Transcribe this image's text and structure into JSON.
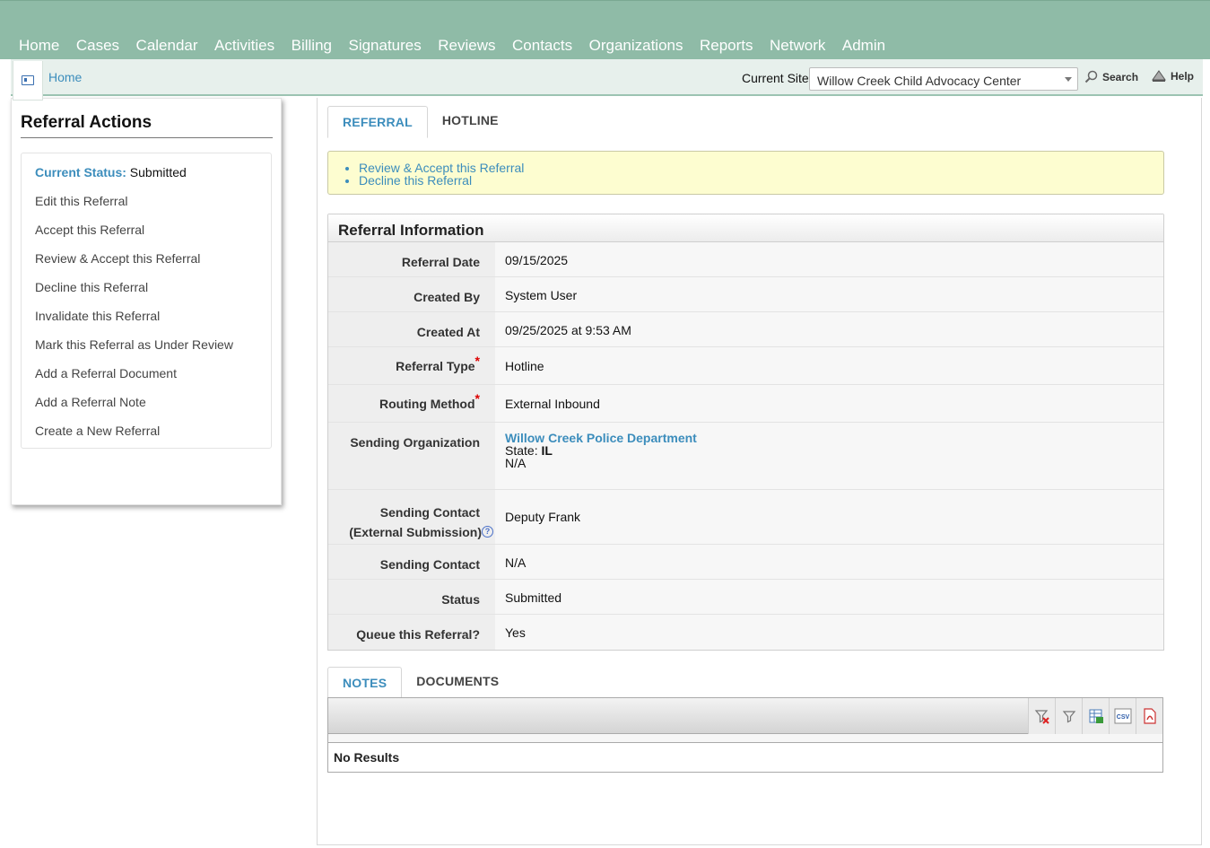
{
  "nav": {
    "items": [
      "Home",
      "Cases",
      "Calendar",
      "Activities",
      "Billing",
      "Signatures",
      "Reviews",
      "Contacts",
      "Organizations",
      "Reports",
      "Network",
      "Admin"
    ]
  },
  "subbar": {
    "breadcrumb": "Home",
    "site_label": "Current Site",
    "site_value": "Willow Creek Child Advocacy Center",
    "search_label": "Search",
    "help_label": "Help"
  },
  "left": {
    "title": "Referral Actions",
    "status_label": "Current Status:",
    "status_value": "Submitted",
    "actions": [
      "Edit this Referral",
      "Accept this Referral",
      "Review & Accept this Referral",
      "Decline this Referral",
      "Invalidate this Referral",
      "Mark this Referral as Under Review",
      "Add a Referral Document",
      "Add a Referral Note",
      "Create a New Referral"
    ]
  },
  "main": {
    "tabs": [
      "REFERRAL",
      "HOTLINE"
    ],
    "notice_links": [
      "Review & Accept this Referral",
      "Decline this Referral"
    ],
    "info_title": "Referral Information",
    "fields": {
      "referral_date_label": "Referral Date",
      "referral_date": "09/15/2025",
      "created_by_label": "Created By",
      "created_by": "System User",
      "created_at_label": "Created At",
      "created_at": "09/25/2025 at 9:53 AM",
      "referral_type_label": "Referral Type",
      "referral_type": "Hotline",
      "routing_method_label": "Routing Method",
      "routing_method": "External Inbound",
      "sending_org_label": "Sending Organization",
      "sending_org_name": "Willow Creek Police Department",
      "sending_org_state_label": "State:",
      "sending_org_state": "IL",
      "sending_org_extra": "N/A",
      "sending_contact_ext_label_1": "Sending Contact",
      "sending_contact_ext_label_2": "(External Submission)",
      "sending_contact_ext": "Deputy Frank",
      "sending_contact_label": "Sending Contact",
      "sending_contact": "N/A",
      "status_label": "Status",
      "status": "Submitted",
      "queue_label": "Queue this Referral?",
      "queue": "Yes"
    },
    "required_mark": "*",
    "help_glyph": "?",
    "bottom_tabs": [
      "NOTES",
      "DOCUMENTS"
    ],
    "grid_empty": "No Results",
    "grid_tools": [
      "clear-filter-icon",
      "filter-icon",
      "excel-export-icon",
      "csv-export-icon",
      "pdf-export-icon"
    ],
    "csv_glyph": "CSV"
  },
  "colors": {
    "nav_bg": "#8fbba7",
    "subbar_bg": "#e7f0ec",
    "link": "#3c8dbc",
    "notice_bg": "#fdfdd0",
    "required": "#dd0000"
  }
}
